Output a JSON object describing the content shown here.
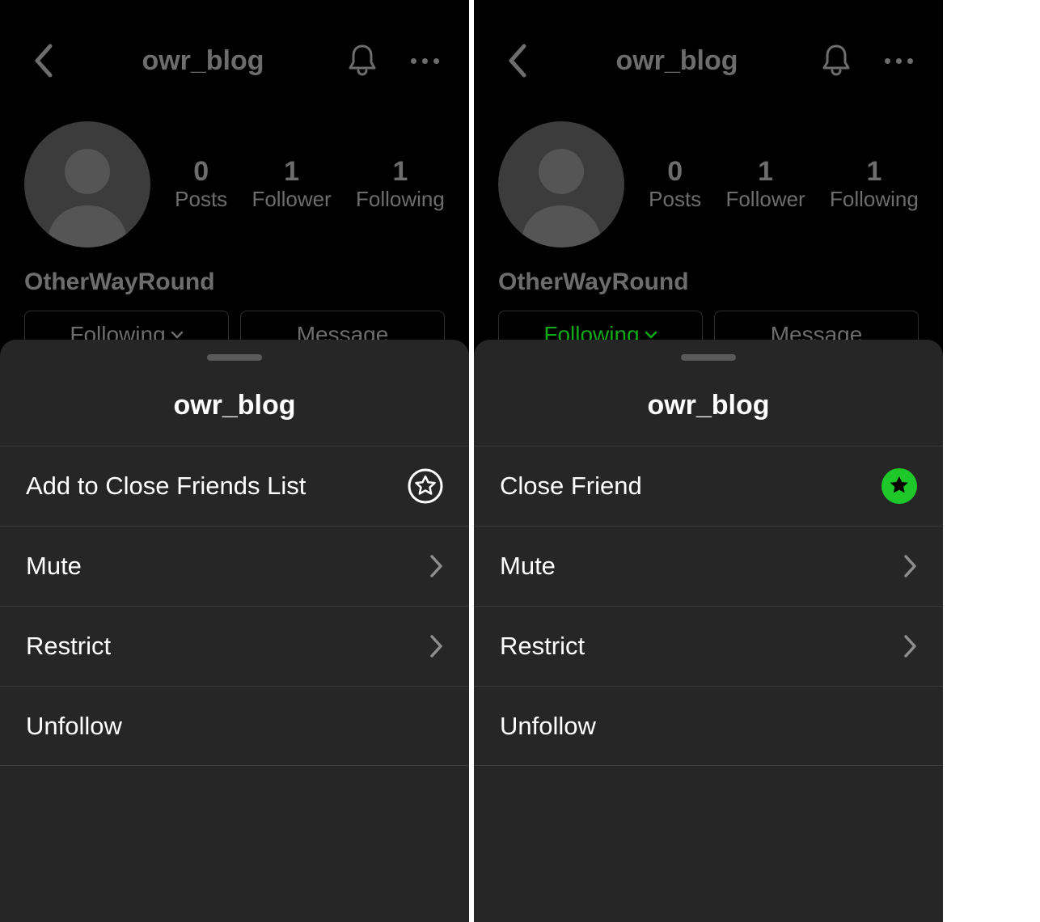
{
  "panes": [
    {
      "header": {
        "username": "owr_blog"
      },
      "profile": {
        "stats": [
          {
            "n": "0",
            "l": "Posts"
          },
          {
            "n": "1",
            "l": "Follower"
          },
          {
            "n": "1",
            "l": "Following"
          }
        ],
        "display_name": "OtherWayRound",
        "following_label": "Following",
        "following_green": false,
        "message_label": "Message"
      },
      "sheet": {
        "title": "owr_blog",
        "rows": [
          {
            "label": "Add to Close Friends List",
            "trailing": "star-outline"
          },
          {
            "label": "Mute",
            "trailing": "chevron"
          },
          {
            "label": "Restrict",
            "trailing": "chevron"
          },
          {
            "label": "Unfollow",
            "trailing": "none"
          }
        ]
      }
    },
    {
      "header": {
        "username": "owr_blog"
      },
      "profile": {
        "stats": [
          {
            "n": "0",
            "l": "Posts"
          },
          {
            "n": "1",
            "l": "Follower"
          },
          {
            "n": "1",
            "l": "Following"
          }
        ],
        "display_name": "OtherWayRound",
        "following_label": "Following",
        "following_green": true,
        "message_label": "Message"
      },
      "sheet": {
        "title": "owr_blog",
        "rows": [
          {
            "label": "Close Friend",
            "trailing": "star-solid"
          },
          {
            "label": "Mute",
            "trailing": "chevron"
          },
          {
            "label": "Restrict",
            "trailing": "chevron"
          },
          {
            "label": "Unfollow",
            "trailing": "none"
          }
        ]
      }
    }
  ]
}
